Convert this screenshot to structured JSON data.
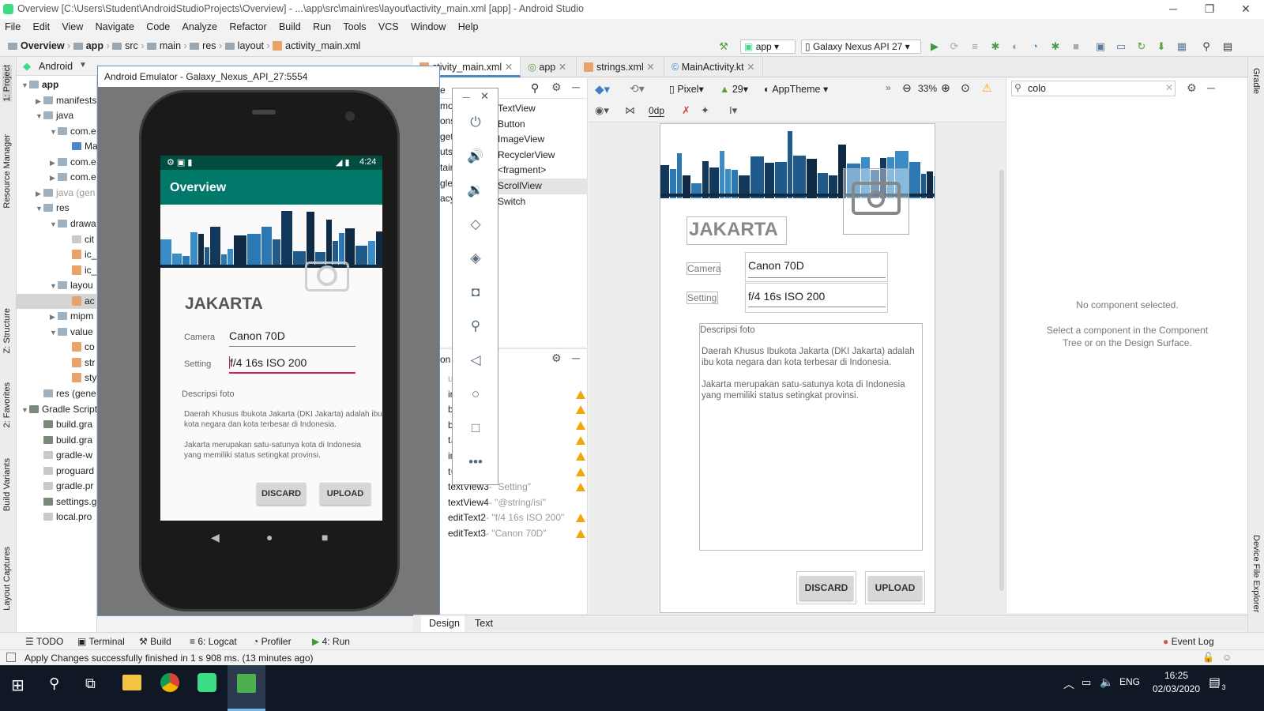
{
  "window": {
    "title": "Overview [C:\\Users\\Student\\AndroidStudioProjects\\Overview] - ...\\app\\src\\main\\res\\layout\\activity_main.xml [app] - Android Studio",
    "controls": [
      "─",
      "❐",
      "✕"
    ]
  },
  "menu": [
    "File",
    "Edit",
    "View",
    "Navigate",
    "Code",
    "Analyze",
    "Refactor",
    "Build",
    "Run",
    "Tools",
    "VCS",
    "Window",
    "Help"
  ],
  "breadcrumb": [
    "Overview",
    "app",
    "src",
    "main",
    "res",
    "layout",
    "activity_main.xml"
  ],
  "toolbar": {
    "run_config": "app",
    "device": "Galaxy Nexus API 27"
  },
  "left_strip": [
    "1: Project",
    "Resource Manager",
    "Z: Structure",
    "2: Favorites",
    "Build Variants",
    "Layout Captures"
  ],
  "right_strip": [
    "Gradle",
    "Device File Explorer"
  ],
  "project": {
    "view": "Android",
    "tree": [
      {
        "label": "app",
        "depth": 0,
        "arrow": "▼",
        "icon": "folder",
        "bold": true
      },
      {
        "label": "manifests",
        "depth": 1,
        "arrow": "▶",
        "icon": "folder"
      },
      {
        "label": "java",
        "depth": 1,
        "arrow": "▼",
        "icon": "folder"
      },
      {
        "label": "com.e",
        "depth": 2,
        "arrow": "▼",
        "icon": "folder"
      },
      {
        "label": "Ma",
        "depth": 3,
        "arrow": "",
        "icon": "kotlin"
      },
      {
        "label": "com.e",
        "depth": 2,
        "arrow": "▶",
        "icon": "folder"
      },
      {
        "label": "com.e",
        "depth": 2,
        "arrow": "▶",
        "icon": "folder"
      },
      {
        "label": "java (gen",
        "depth": 1,
        "arrow": "▶",
        "icon": "folder",
        "gray_suffix": true
      },
      {
        "label": "res",
        "depth": 1,
        "arrow": "▼",
        "icon": "folder"
      },
      {
        "label": "drawa",
        "depth": 2,
        "arrow": "▼",
        "icon": "folder"
      },
      {
        "label": "cit",
        "depth": 3,
        "arrow": "",
        "icon": "file"
      },
      {
        "label": "ic_",
        "depth": 3,
        "arrow": "",
        "icon": "xml"
      },
      {
        "label": "ic_",
        "depth": 3,
        "arrow": "",
        "icon": "xml"
      },
      {
        "label": "layou",
        "depth": 2,
        "arrow": "▼",
        "icon": "folder"
      },
      {
        "label": "ac",
        "depth": 3,
        "arrow": "",
        "icon": "xml",
        "selected": true
      },
      {
        "label": "mipm",
        "depth": 2,
        "arrow": "▶",
        "icon": "folder"
      },
      {
        "label": "value",
        "depth": 2,
        "arrow": "▼",
        "icon": "folder"
      },
      {
        "label": "co",
        "depth": 3,
        "arrow": "",
        "icon": "xml"
      },
      {
        "label": "str",
        "depth": 3,
        "arrow": "",
        "icon": "xml"
      },
      {
        "label": "sty",
        "depth": 3,
        "arrow": "",
        "icon": "xml"
      },
      {
        "label": "res (gene",
        "depth": 1,
        "arrow": "",
        "icon": "folder"
      },
      {
        "label": "Gradle Scripts",
        "depth": 0,
        "arrow": "▼",
        "icon": "gradle"
      },
      {
        "label": "build.gra",
        "depth": 1,
        "arrow": "",
        "icon": "gradle"
      },
      {
        "label": "build.gra",
        "depth": 1,
        "arrow": "",
        "icon": "gradle"
      },
      {
        "label": "gradle-w",
        "depth": 1,
        "arrow": "",
        "icon": "file"
      },
      {
        "label": "proguard",
        "depth": 1,
        "arrow": "",
        "icon": "file"
      },
      {
        "label": "gradle.pr",
        "depth": 1,
        "arrow": "",
        "icon": "file"
      },
      {
        "label": "settings.g",
        "depth": 1,
        "arrow": "",
        "icon": "gradle"
      },
      {
        "label": "local.pro",
        "depth": 1,
        "arrow": "",
        "icon": "file"
      }
    ]
  },
  "emulator": {
    "title": "Android Emulator - Galaxy_Nexus_API_27:5554",
    "time": "4:24",
    "app_title": "Overview",
    "city_title": "JAKARTA",
    "camera_label": "Camera",
    "camera_value": "Canon 70D",
    "setting_label": "Setting",
    "setting_value": "f/4 16s ISO 200",
    "desc_label": "Descripsi foto",
    "desc_p1": "Daerah Khusus Ibukota Jakarta (DKI Jakarta) adalah ibu kota negara dan kota terbesar di Indonesia.",
    "desc_p2": "Jakarta merupakan satu-satunya kota di Indonesia yang memiliki status setingkat provinsi.",
    "discard": "DISCARD",
    "upload": "UPLOAD"
  },
  "tabs": [
    {
      "label": "ctivity_main.xml",
      "active": true
    },
    {
      "label": "app"
    },
    {
      "label": "strings.xml"
    },
    {
      "label": "MainActivity.kt"
    }
  ],
  "palette": [
    "TextView",
    "Button",
    "ImageView",
    "RecyclerView",
    "<fragment>",
    "ScrollView",
    "Switch"
  ],
  "palette_left_cut": [
    "e",
    "mo",
    "ons",
    "get",
    "uts",
    "tain",
    "gle",
    "acy"
  ],
  "component_tree": {
    "header": "on",
    "rows": [
      {
        "name": "",
        "detail": "ut",
        "warn": false
      },
      {
        "name": "im",
        "detail": "",
        "warn": true
      },
      {
        "name": "b",
        "detail": "LOAD\"",
        "warn": true
      },
      {
        "name": "b",
        "detail": "SCARD\"",
        "warn": true
      },
      {
        "name": "t",
        "detail": "AKARTA\"",
        "warn": true
      },
      {
        "name": "im",
        "detail": "",
        "warn": true
      },
      {
        "name": "t",
        "detail": "Camera\"",
        "warn": true
      },
      {
        "name": "textView3",
        "detail": "- \"Setting\"",
        "warn": true
      },
      {
        "name": "textView4",
        "detail": "- \"@string/isi\"",
        "warn": false
      },
      {
        "name": "editText2",
        "detail": "- \"f/4 16s ISO 200\"",
        "warn": true
      },
      {
        "name": "editText3",
        "detail": "- \"Canon 70D\"",
        "warn": true
      }
    ]
  },
  "design_toolbar": {
    "device": "Pixel",
    "api": "29",
    "theme": "AppTheme",
    "zoom": "33%",
    "margin": "0dp"
  },
  "blueprint": {
    "city_title": "JAKARTA",
    "camera_label": "Camera",
    "camera_value": "Canon 70D",
    "setting_label": "Setting",
    "setting_value": "f/4 16s ISO 200",
    "desc_label": "Descripsi foto",
    "desc_p1": "Daerah Khusus Ibukota Jakarta (DKI Jakarta) adalah ibu kota negara dan kota terbesar di Indonesia.",
    "desc_p2": "Jakarta merupakan satu-satunya kota di Indonesia yang memiliki status setingkat provinsi.",
    "discard": "DISCARD",
    "upload": "UPLOAD"
  },
  "attributes": {
    "search": "colo",
    "no_selection": "No component selected.",
    "hint": "Select a component in the Component Tree or on the Design Surface."
  },
  "editor_mode_tabs": [
    "Design",
    "Text"
  ],
  "tool_windows": [
    "TODO",
    "Terminal",
    "Build",
    "6: Logcat",
    "Profiler",
    "4: Run"
  ],
  "event_log": "Event Log",
  "status_text": "Apply Changes successfully finished in 1 s 908 ms. (13 minutes ago)",
  "taskbar": {
    "lang": "ENG",
    "time": "16:25",
    "date": "02/03/2020",
    "notif_count": "3"
  },
  "colors": {
    "accent": "#00796b",
    "status_bar": "#004d40",
    "warning": "#f2a60a"
  }
}
